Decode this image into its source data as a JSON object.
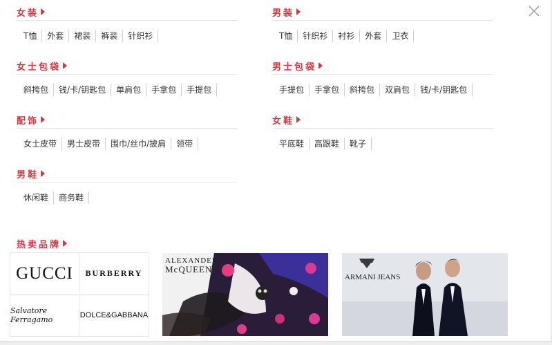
{
  "categories": [
    {
      "id": "women-clothing",
      "title": "女装",
      "links": [
        "T恤",
        "外套",
        "裙装",
        "裤装",
        "针织衫"
      ]
    },
    {
      "id": "men-clothing",
      "title": "男装",
      "links": [
        "T恤",
        "针织衫",
        "衬衫",
        "外套",
        "卫衣"
      ]
    },
    {
      "id": "women-bags",
      "title": "女士包袋",
      "links": [
        "斜挎包",
        "钱/卡/钥匙包",
        "单肩包",
        "手拿包",
        "手提包"
      ]
    },
    {
      "id": "men-bags",
      "title": "男士包袋",
      "links": [
        "手提包",
        "手拿包",
        "斜挎包",
        "双肩包",
        "钱/卡/钥匙包"
      ]
    },
    {
      "id": "accessories",
      "title": "配饰",
      "links": [
        "女士皮带",
        "男士皮带",
        "围巾/丝巾/披肩",
        "领带"
      ]
    },
    {
      "id": "women-shoes",
      "title": "女鞋",
      "links": [
        "平底鞋",
        "高跟鞋",
        "靴子"
      ]
    },
    {
      "id": "men-shoes",
      "title": "男鞋",
      "links": [
        "休闲鞋",
        "商务鞋"
      ]
    }
  ],
  "brands": {
    "title": "热卖品牌",
    "logos": [
      "GUCCI",
      "BURBERRY",
      "Salvatore Ferragamo",
      "DOLCE&GABBANA"
    ],
    "banners": [
      {
        "id": "alexander-mcqueen",
        "label_line1": "ALEXANDER",
        "label_line2": "McQUEEN"
      },
      {
        "id": "armani-jeans",
        "label": "ARMANI JEANS"
      }
    ]
  },
  "colors": {
    "accent": "#d8343f",
    "divider": "#e6e6e6"
  }
}
